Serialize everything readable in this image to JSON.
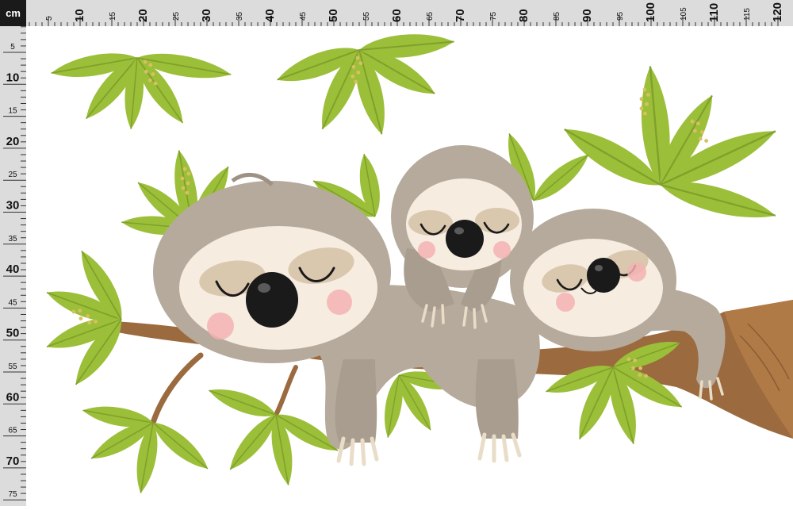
{
  "ruler": {
    "unit_label": "cm",
    "horizontal_labels": [
      "5",
      "10",
      "15",
      "20",
      "25",
      "30",
      "35",
      "40",
      "45",
      "50",
      "55",
      "60",
      "65",
      "70",
      "75",
      "80",
      "85",
      "90",
      "95",
      "100",
      "105",
      "110",
      "115",
      "120"
    ],
    "vertical_labels": [
      "5",
      "10",
      "15",
      "20",
      "25",
      "30",
      "35",
      "40",
      "45",
      "50",
      "55",
      "60",
      "65",
      "70",
      "75"
    ]
  },
  "colors": {
    "ruler_bg": "#dcdcdc",
    "ruler_corner": "#1a1a1a",
    "leaf": "#9cbf3a",
    "leaf_dark": "#7fa12a",
    "branch": "#9b6a3e",
    "sloth_fur": "#b6aa9c",
    "sloth_face": "#f6ece0",
    "eye_patch": "#d9c7ae",
    "nose": "#1a1a1a",
    "cheek": "#f3b3b3"
  },
  "illustration": {
    "subject": "three-sleeping-sloths-on-branch",
    "sloth_count": 3
  }
}
